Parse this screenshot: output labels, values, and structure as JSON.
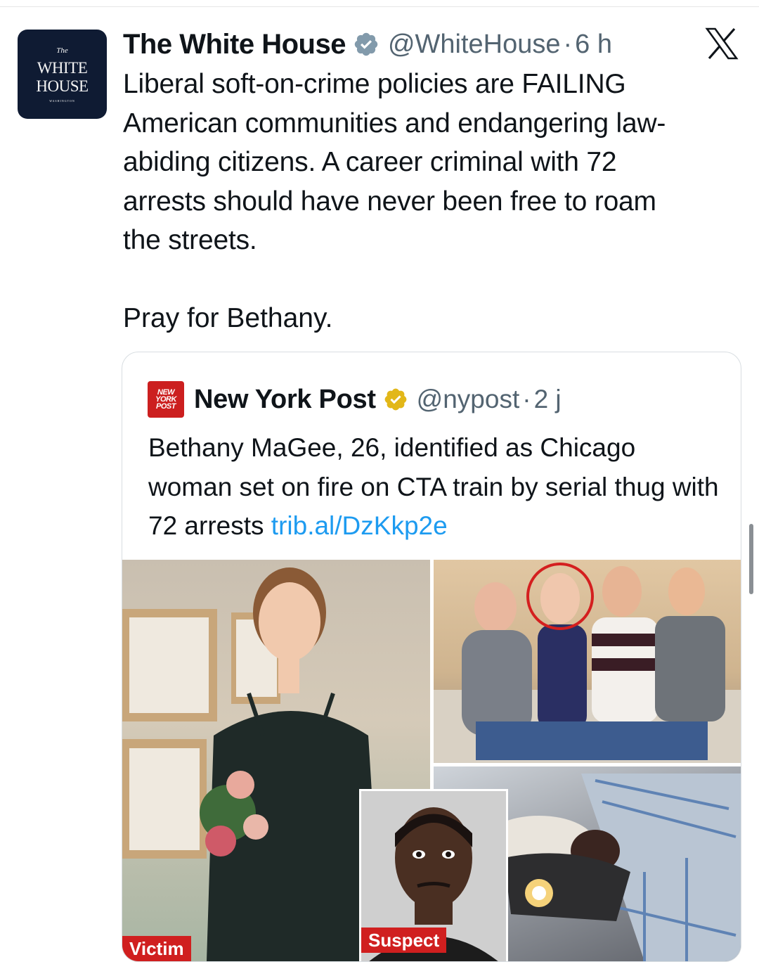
{
  "tweet": {
    "author": {
      "name": "The White House",
      "handle": "@WhiteHouse",
      "separator": "·",
      "time": "6 h",
      "avatar_text": {
        "the": "The",
        "line1": "WHITE",
        "line2": "HOUSE",
        "sub": "WASHINGTON"
      }
    },
    "text": "Liberal soft-on-crime policies are FAILING\nAmerican communities and endangering law-\nabiding citizens. A career criminal with 72\narrests should have never been free to roam\nthe streets.",
    "text_line2": "Pray for Bethany.",
    "platform_logo": "x-logo"
  },
  "quote": {
    "author": {
      "name": "New York Post",
      "handle": "@nypost",
      "separator": "·",
      "time": "2 j",
      "logo_lines": [
        "NEW",
        "YORK",
        "POST"
      ]
    },
    "text": "Bethany MaGee, 26, identified as Chicago woman set on fire on CTA train by serial thug with 72 arrests ",
    "link": "trib.al/DzKkp2e",
    "images": {
      "victim_tag": "Victim",
      "suspect_tag": "Suspect"
    }
  },
  "colors": {
    "avatar_bg": "#0f1b33",
    "link": "#1d9bf0",
    "muted": "#536471",
    "tag_red": "#d01f1f",
    "verified_gray": "#829aab",
    "verified_gold": "#e2b719"
  }
}
